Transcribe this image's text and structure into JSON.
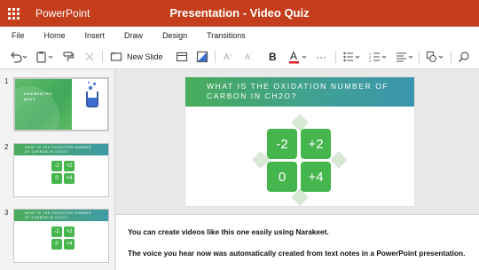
{
  "titlebar": {
    "app_name": "PowerPoint",
    "doc_title": "Presentation - Video Quiz",
    "color": "#c43e1c"
  },
  "menu": {
    "items": [
      "File",
      "Home",
      "Insert",
      "Draw",
      "Design",
      "Transitions"
    ]
  },
  "toolbar": {
    "new_slide_label": "New Slide",
    "icons": [
      "undo-icon",
      "clipboard-icon",
      "format-painter-icon",
      "clear-icon",
      "new-slide-icon",
      "layout-icon",
      "shape-icon",
      "font-size-up-icon",
      "font-size-down-icon",
      "bold-icon",
      "font-color-icon",
      "more-icon",
      "bullets-icon",
      "numbering-icon",
      "align-icon",
      "shapes-icon",
      "search-icon"
    ]
  },
  "thumbnails": [
    {
      "number": "1",
      "title": "CHEMISTRY QUIZ"
    },
    {
      "number": "2",
      "question": "WHAT IS THE OXIDATION NUMBER OF CARBON IN CH2O?",
      "answers": [
        "-2",
        "+2",
        "0",
        "+4"
      ]
    },
    {
      "number": "3",
      "question": "WHAT IS THE OXIDATION NUMBER OF CARBON IN CH2O?",
      "answers": [
        "-2",
        "+2",
        "0",
        "+4"
      ]
    }
  ],
  "slide": {
    "question": "WHAT IS THE OXIDATION NUMBER OF CARBON IN CH2O?",
    "answers": [
      "-2",
      "+2",
      "0",
      "+4"
    ],
    "answer_color": "#45b54d"
  },
  "notes": {
    "line1": "You can create videos like this one easily using Narakeet.",
    "line2": "The voice you hear now was automatically created from text notes in a PowerPoint presentation."
  }
}
